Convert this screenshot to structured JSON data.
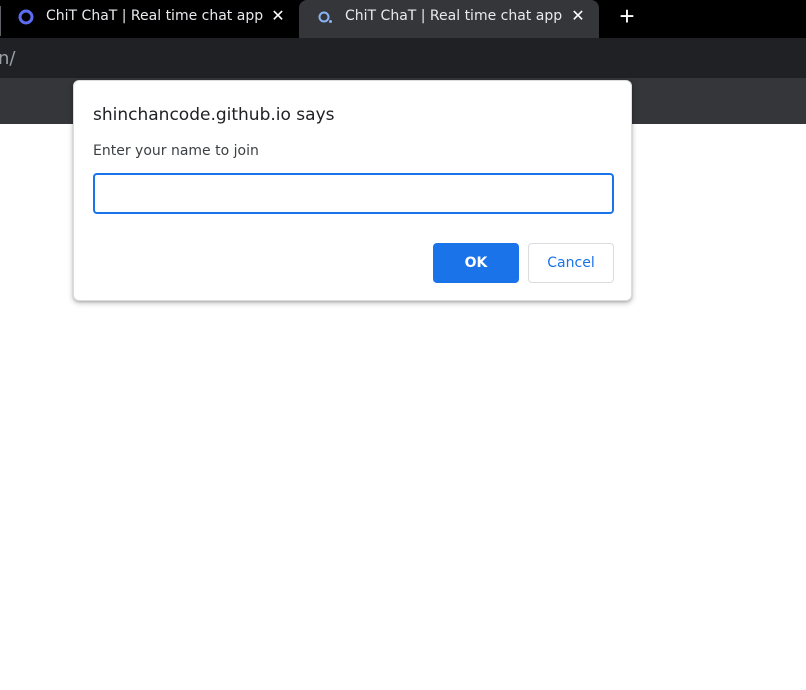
{
  "browser": {
    "tabs": [
      {
        "title": "ChiT ChaT | Real time chat app",
        "active": false
      },
      {
        "title": "ChiT ChaT | Real time chat app",
        "active": true
      }
    ],
    "close_symbol": "✕",
    "new_tab_symbol": "+",
    "url_fragment": "n/"
  },
  "dialog": {
    "origin": "shinchancode.github.io says",
    "message": "Enter your name to join",
    "input_value": "",
    "ok_label": "OK",
    "cancel_label": "Cancel"
  },
  "colors": {
    "accent": "#1a73e8",
    "favicon": "#5b6cf0"
  }
}
